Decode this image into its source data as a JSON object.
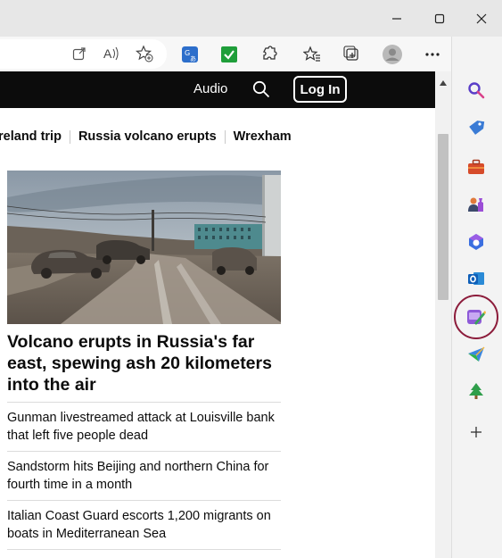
{
  "window": {
    "controls": [
      "minimize",
      "maximize",
      "close"
    ]
  },
  "toolbar": {
    "icons": [
      "open-in-app-icon",
      "read-aloud-icon",
      "add-favorite-icon",
      "translate-icon",
      "checkmark-extension-icon",
      "extensions-icon",
      "favorites-icon",
      "collections-icon",
      "profile-icon",
      "more-icon",
      "bing-copilot-icon"
    ]
  },
  "header": {
    "audio_label": "Audio",
    "login_label": "Log In"
  },
  "trending": {
    "items": [
      "ireland trip",
      "Russia volcano erupts",
      "Wrexham"
    ]
  },
  "article": {
    "headline": "Volcano erupts in Russia's far east, spewing ash 20 kilometers into the air"
  },
  "stories": [
    "Gunman livestreamed attack at Louisville bank that left five people dead",
    "Sandstorm hits Beijing and northern China for fourth time in a month",
    "Italian Coast Guard escorts 1,200 migrants on boats in Mediterranean Sea"
  ],
  "sidebar": {
    "icons": [
      "search-icon",
      "shopping-tag-icon",
      "tools-briefcase-icon",
      "games-icon",
      "microsoft-365-icon",
      "outlook-icon",
      "designer-icon",
      "drop-icon",
      "tree-icon",
      "add-icon"
    ],
    "highlighted": "designer-icon"
  },
  "colors": {
    "cnn_header": "#0c0c0c",
    "highlight_ring": "#8c1c3b",
    "edge_blue": "#1b6ed6"
  }
}
